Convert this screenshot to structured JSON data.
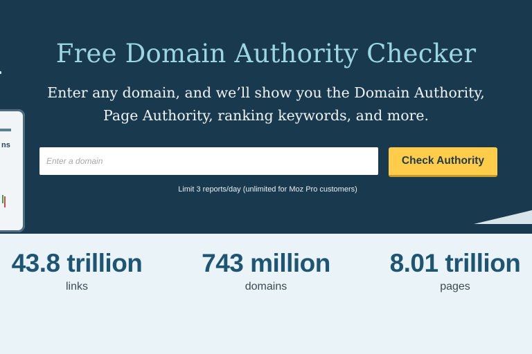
{
  "hero": {
    "title": "Free Domain Authority Checker",
    "subtitle": "Enter any domain, and we’ll show you the Domain Authority, Page Authority, ranking keywords, and more.",
    "background_color": "#19394f",
    "title_color": "#9cd6e0"
  },
  "search": {
    "placeholder": "Enter a domain",
    "value": "",
    "button_label": "Check Authority",
    "button_color": "#ffcd4a",
    "limit_note": "Limit 3 reports/day (unlimited for Moz Pro customers)"
  },
  "stats": [
    {
      "value": "43.8 trillion",
      "label": "links"
    },
    {
      "value": "743 million",
      "label": "domains"
    },
    {
      "value": "8.01 trillion",
      "label": "pages"
    }
  ],
  "decor": {
    "left_card_text": "ns",
    "accent_color": "#1e5572"
  }
}
